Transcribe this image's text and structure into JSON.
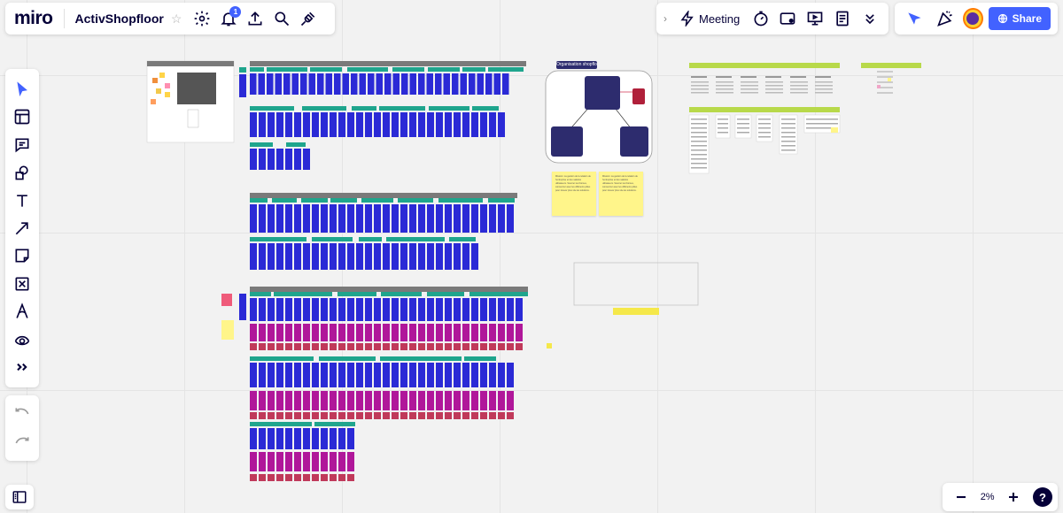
{
  "app": {
    "logo": "miro",
    "board_name": "ActivShopfloor",
    "notifications_count": "1"
  },
  "top_tools": {
    "meeting_label": "Meeting"
  },
  "share": {
    "label": "Share"
  },
  "zoom": {
    "value": "2%"
  },
  "help": {
    "label": "?"
  },
  "canvas": {
    "diagram_title": "Organisation shopfloor",
    "sticky_note_texts": [
      "Mission: La gestion de la relation de l'entreprise et des salariés utilisateurs. Sourcer les thèmes, concentrer avec les différents pôles pour trouver plus vite les solutions.",
      ""
    ]
  },
  "colors": {
    "accent": "#4262ff",
    "card_blue": "#2b2ad6",
    "card_magenta": "#b0179a",
    "card_rose": "#c0395a",
    "header_teal": "#1fa58d",
    "frame_grey": "#7a7a7a",
    "lime": "#b8d94a",
    "sticky_yellow": "#fff58a",
    "navy": "#2d2c6e"
  }
}
